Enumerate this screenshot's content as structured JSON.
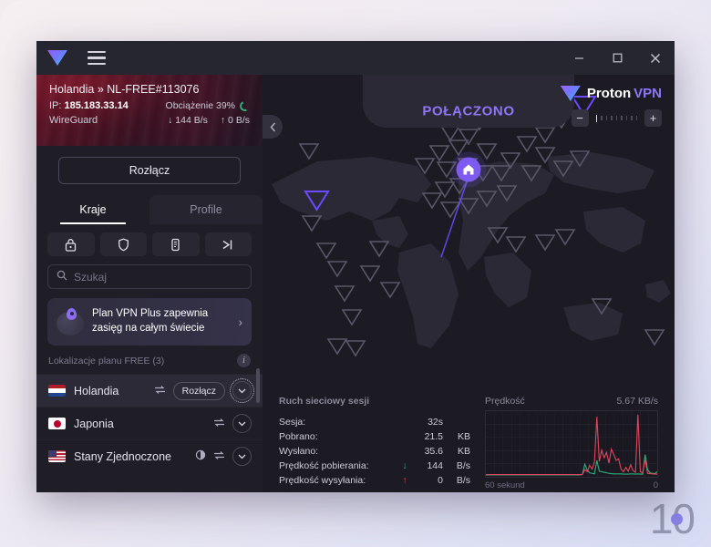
{
  "window": {
    "logo_icon": "proton-logo-icon",
    "menu_icon": "hamburger-icon",
    "minimize_label": "—",
    "maximize_label": "□",
    "close_label": "✕"
  },
  "sidebar": {
    "connection": {
      "server_line": "Holandia » NL-FREE#113076",
      "ip_label": "IP:",
      "ip_value": "185.183.33.14",
      "load_label": "Obciążenie 39%",
      "protocol": "WireGuard",
      "download_speed": "↓ 144 B/s",
      "upload_speed": "↑ 0 B/s"
    },
    "disconnect_label": "Rozłącz",
    "tabs": [
      {
        "label": "Kraje",
        "active": true
      },
      {
        "label": "Profile",
        "active": false
      }
    ],
    "quick_icons": [
      {
        "name": "secure-core-lock-icon"
      },
      {
        "name": "netshield-shield-icon"
      },
      {
        "name": "tor-onion-icon"
      },
      {
        "name": "p2p-arrow-icon"
      }
    ],
    "search": {
      "placeholder": "Szukaj",
      "value": "",
      "icon": "search-icon"
    },
    "promo": {
      "text": "Plan VPN Plus zapewnia zasięg na całym świecie",
      "chevron": "›",
      "icon": "globe-pin-icon"
    },
    "free_section": {
      "title": "Lokalizacje planu FREE (3)",
      "info_icon": "info-icon",
      "info_label": "i"
    },
    "countries": [
      {
        "name": "Holandia",
        "flag": "nl",
        "active": true,
        "p2p_icon": true,
        "tor_icon": false,
        "action_label": "Rozłącz",
        "chevron": "⌄"
      },
      {
        "name": "Japonia",
        "flag": "jp",
        "active": false,
        "p2p_icon": true,
        "tor_icon": false,
        "action_label": "",
        "chevron": "⌄"
      },
      {
        "name": "Stany Zjednoczone",
        "flag": "us",
        "active": false,
        "p2p_icon": true,
        "tor_icon": true,
        "action_label": "",
        "chevron": "⌄"
      }
    ],
    "collapse_icon": "chevron-left-icon"
  },
  "main": {
    "status": "POŁĄCZONO",
    "home_icon": "home-icon",
    "brand": {
      "word1": "Proton",
      "word2": "VPN",
      "icon": "proton-logo-icon"
    },
    "zoom": {
      "minus": "−",
      "plus": "+",
      "level_ticks": 9,
      "active_tick": 1
    },
    "cursor_icon": "mouse-pointer-icon"
  },
  "stats": {
    "title": "Ruch sieciowy sesji",
    "rows": [
      {
        "label": "Sesja:",
        "arrow": "",
        "value": "32s",
        "unit": ""
      },
      {
        "label": "Pobrano:",
        "arrow": "",
        "value": "21.5",
        "unit": "KB"
      },
      {
        "label": "Wysłano:",
        "arrow": "",
        "value": "35.6",
        "unit": "KB"
      },
      {
        "label": "Prędkość pobierania:",
        "arrow": "↓",
        "arrow_dir": "dn",
        "value": "144",
        "unit": "B/s"
      },
      {
        "label": "Prędkość wysyłania:",
        "arrow": "↑",
        "arrow_dir": "up",
        "value": "0",
        "unit": "B/s"
      }
    ]
  },
  "chart_data": {
    "type": "line",
    "title": "Prędkość",
    "peak_label": "5.67  KB/s",
    "xlabel_left": "60 sekund",
    "xlabel_right": "0",
    "grid": true,
    "ylim": [
      0,
      5.67
    ],
    "xlim": [
      60,
      0
    ],
    "legend": [
      "upload",
      "download"
    ],
    "colors": {
      "upload": "#e0465c",
      "download": "#2fae7e"
    },
    "series": [
      {
        "name": "upload",
        "color": "#e0465c",
        "values": [
          0.04,
          0.04,
          0.04,
          0.04,
          0.04,
          0.04,
          0.04,
          0.04,
          0.04,
          0.04,
          0.04,
          0.04,
          0.04,
          0.04,
          0.04,
          0.04,
          0.04,
          0.04,
          0.04,
          0.04,
          0.04,
          0.04,
          0.04,
          0.04,
          0.04,
          0.04,
          0.04,
          0.04,
          0.04,
          0.04,
          0.04,
          0.04,
          0.04,
          0.04,
          0.04,
          0.04,
          0.04,
          0.04,
          0.04,
          0.04,
          0.04,
          0.5,
          0.3,
          0.9,
          0.55,
          1.2,
          5.4,
          1.25,
          2.3,
          1.6,
          2.1,
          1.1,
          2.4,
          1.9,
          1.35,
          1.5,
          0.55,
          0.3,
          0.7,
          0.35,
          0.95,
          0.4,
          0.25,
          5.6,
          0.3,
          0.2,
          1.45,
          0.15,
          0.12,
          0.1,
          0.09,
          0.08
        ]
      },
      {
        "name": "download",
        "color": "#2fae7e",
        "values": [
          0.0,
          0.0,
          0.0,
          0.0,
          0.0,
          0.0,
          0.0,
          0.0,
          0.0,
          0.0,
          0.0,
          0.0,
          0.0,
          0.0,
          0.0,
          0.0,
          0.0,
          0.0,
          0.0,
          0.0,
          0.0,
          0.0,
          0.0,
          0.0,
          0.0,
          0.0,
          0.0,
          0.0,
          0.0,
          0.0,
          0.0,
          0.0,
          0.0,
          0.0,
          0.0,
          0.0,
          0.0,
          0.0,
          0.0,
          0.0,
          0.05,
          1.0,
          0.45,
          0.2,
          0.15,
          0.1,
          1.35,
          0.35,
          0.3,
          0.25,
          0.2,
          0.15,
          0.12,
          0.1,
          0.1,
          0.1,
          0.1,
          0.08,
          0.08,
          0.08,
          0.1,
          0.1,
          0.08,
          0.1,
          0.08,
          0.08,
          1.9,
          0.5,
          0.2,
          0.15,
          0.12,
          0.3
        ]
      }
    ]
  },
  "watermark": {
    "text": "10"
  }
}
